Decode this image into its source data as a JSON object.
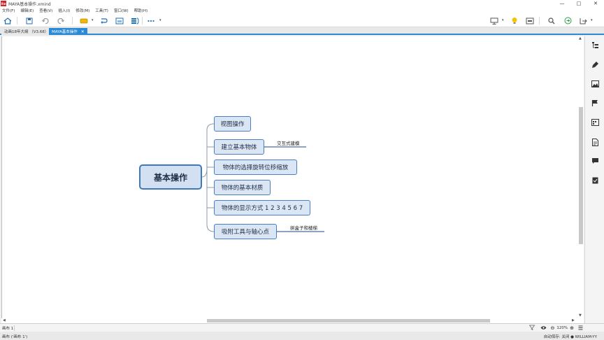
{
  "window": {
    "title": "MAYA基本操作.xmind",
    "logo_text": "Xm",
    "minimize": "—",
    "maximize": "□",
    "close": "✕"
  },
  "menu": [
    "文件(F)",
    "编辑(E)",
    "查看(V)",
    "插入(I)",
    "修改(M)",
    "工具(T)",
    "窗口(W)",
    "帮助(H)"
  ],
  "tabs": [
    {
      "label": "动画18年大纲 （V3.68）",
      "active": false
    },
    {
      "label": "MAYA基本操作",
      "active": true,
      "close": "✕"
    }
  ],
  "mindmap": {
    "central": "基本操作",
    "topics": [
      {
        "label": "视图操作"
      },
      {
        "label": "建立基本物体",
        "subtopic": "交互式建模"
      },
      {
        "label": "物体的选择旋转位移缩放"
      },
      {
        "label": "物体的基本材质"
      },
      {
        "label": "物体的显示方式 1 2 3 4 5 6 7"
      },
      {
        "label": "吸附工具与轴心点",
        "subtopic": "拼盒子和楼梯"
      }
    ]
  },
  "statusbar": {
    "sheet_tab": "画布 1",
    "zoom": "120%",
    "zoom_minus": "⊖",
    "zoom_plus": "⊕",
    "status_left": "画布 ('画布 1')",
    "status_right": "自动保存: 关闭  ● WILLIAM-YY"
  },
  "colors": {
    "accent": "#2b8ad6",
    "node_fill": "#dbe6f5",
    "node_border": "#4a7ebf"
  }
}
